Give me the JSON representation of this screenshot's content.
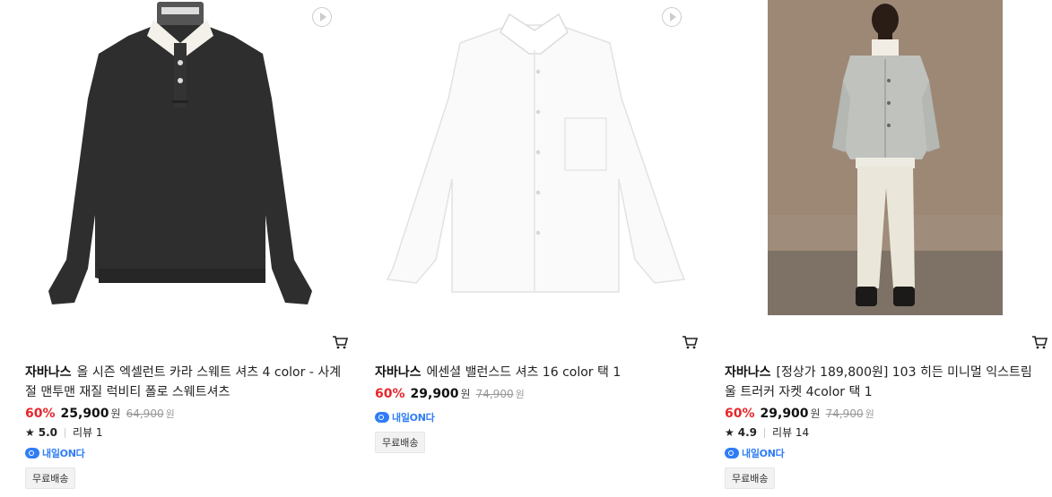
{
  "products": [
    {
      "brand": "자바나스",
      "title": "올 시즌 엑셀런트 카라 스웨트 셔츠 4 color - 사계절 맨투맨 재질 럭비티 폴로 스웨트셔츠",
      "discount": "60%",
      "price": "25,900",
      "won": "원",
      "original_price": "64,900",
      "original_won": "원",
      "rating": "5.0",
      "review_label": "리뷰 1",
      "delivery_badge": "내일ON다",
      "shipping": "무료배송"
    },
    {
      "brand": "자바나스",
      "title": "에센셜 밸런스드 셔츠 16 color 택 1",
      "discount": "60%",
      "price": "29,900",
      "won": "원",
      "original_price": "74,900",
      "original_won": "원",
      "delivery_badge": "내일ON다",
      "shipping": "무료배송"
    },
    {
      "brand": "자바나스",
      "title": "[정상가 189,800원] 103 히든 미니멀 익스트림 울 트러커 자켓 4color 택 1",
      "discount": "60%",
      "price": "29,900",
      "won": "원",
      "original_price": "74,900",
      "original_won": "원",
      "rating": "4.9",
      "review_label": "리뷰 14",
      "delivery_badge": "내일ON다",
      "shipping": "무료배송"
    }
  ],
  "icons": {
    "play": "play-icon",
    "cart": "cart-icon",
    "star": "star-icon"
  },
  "colors": {
    "discount": "#e8262b",
    "badge": "#2f7df6"
  }
}
